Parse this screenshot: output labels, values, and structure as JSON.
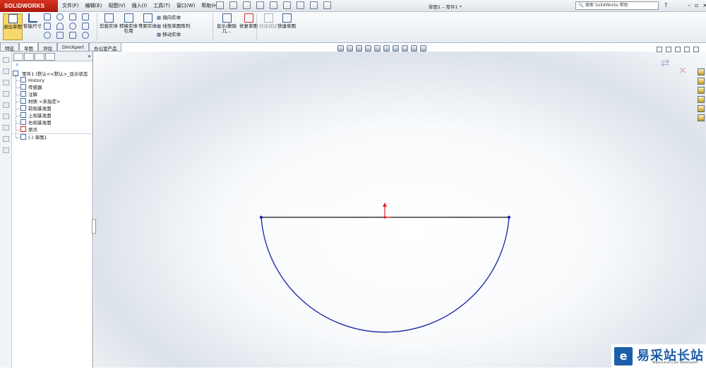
{
  "app": {
    "logo": "SOLIDWORKS",
    "document_title": "草图1 – 零件1 *"
  },
  "menu": [
    "文件(F)",
    "编辑(E)",
    "视图(V)",
    "插入(I)",
    "工具(T)",
    "窗口(W)",
    "帮助(H)"
  ],
  "search": {
    "placeholder": "搜索 SolidWorks 帮助"
  },
  "ribbon": {
    "exit_sketch": "退出草图",
    "smart_dimension": "智能尺寸",
    "trim_entities": "剪裁实体",
    "convert_entities": "转换实体引用",
    "offset_entities": "等距实体",
    "mirror_entities": "镜向实体",
    "linear_pattern": "线性草图阵列",
    "move_entities": "移动实体",
    "display_delete": "显示/删除几...",
    "repair_sketch": "修复草图",
    "quick_snaps": "快速捕捉",
    "rapid_sketch": "快速草图"
  },
  "tabs": [
    "特征",
    "草图",
    "评估",
    "DimXpert",
    "办公室产品"
  ],
  "tree": {
    "root": "零件1 (默认<<默认>_显示状态",
    "items": [
      "History",
      "传感器",
      "注解",
      "材质 <未指定>",
      "前视基准面",
      "上视基准面",
      "右视基准面",
      "原点",
      "(-) 草图1"
    ]
  },
  "watermark": {
    "title": "易采站长站",
    "subtitle": "Www.Easck.Com Webmaster"
  },
  "colors": {
    "sketch_blue": "#1f2fa8",
    "origin_red": "#e52323",
    "selected_tab": "#ffffff"
  }
}
